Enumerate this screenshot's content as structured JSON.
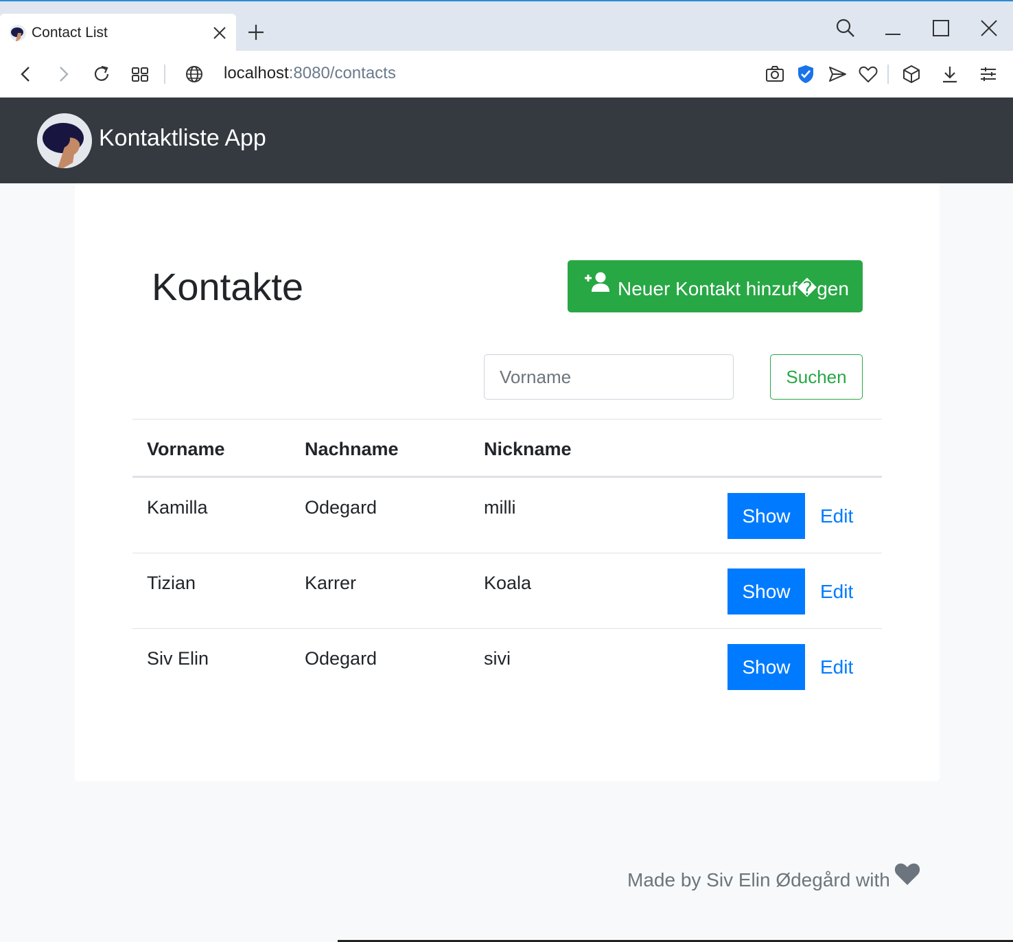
{
  "browser": {
    "tab_title": "Contact List",
    "url_host": "localhost",
    "url_rest": ":8080/contacts"
  },
  "navbar": {
    "brand": "Kontaktliste App"
  },
  "main": {
    "title": "Kontakte",
    "add_button_label": "Neuer Kontakt hinzuf�gen",
    "search": {
      "placeholder": "Vorname",
      "value": "",
      "button_label": "Suchen"
    },
    "table": {
      "headers": [
        "Vorname",
        "Nachname",
        "Nickname"
      ],
      "rows": [
        {
          "first": "Kamilla",
          "last": "Odegard",
          "nick": "milli",
          "show": "Show",
          "edit": "Edit"
        },
        {
          "first": "Tizian",
          "last": "Karrer",
          "nick": "Koala",
          "show": "Show",
          "edit": "Edit"
        },
        {
          "first": "Siv Elin",
          "last": "Odegard",
          "nick": "sivi",
          "show": "Show",
          "edit": "Edit"
        }
      ]
    }
  },
  "footer": {
    "text": "Made by Siv Elin Ødegård with"
  },
  "colors": {
    "navbar_bg": "#343a40",
    "success": "#28a745",
    "primary": "#007bff",
    "page_bg": "#f8f9fa"
  },
  "icons": [
    "avatar-icon",
    "close-icon",
    "plus-icon",
    "search-icon",
    "minimize-icon",
    "maximize-icon",
    "back-icon",
    "forward-icon",
    "reload-icon",
    "tabs-grid-icon",
    "globe-icon",
    "camera-icon",
    "shield-icon",
    "send-icon",
    "heart-icon",
    "cube-icon",
    "download-icon",
    "menu-icon",
    "add-user-icon"
  ]
}
